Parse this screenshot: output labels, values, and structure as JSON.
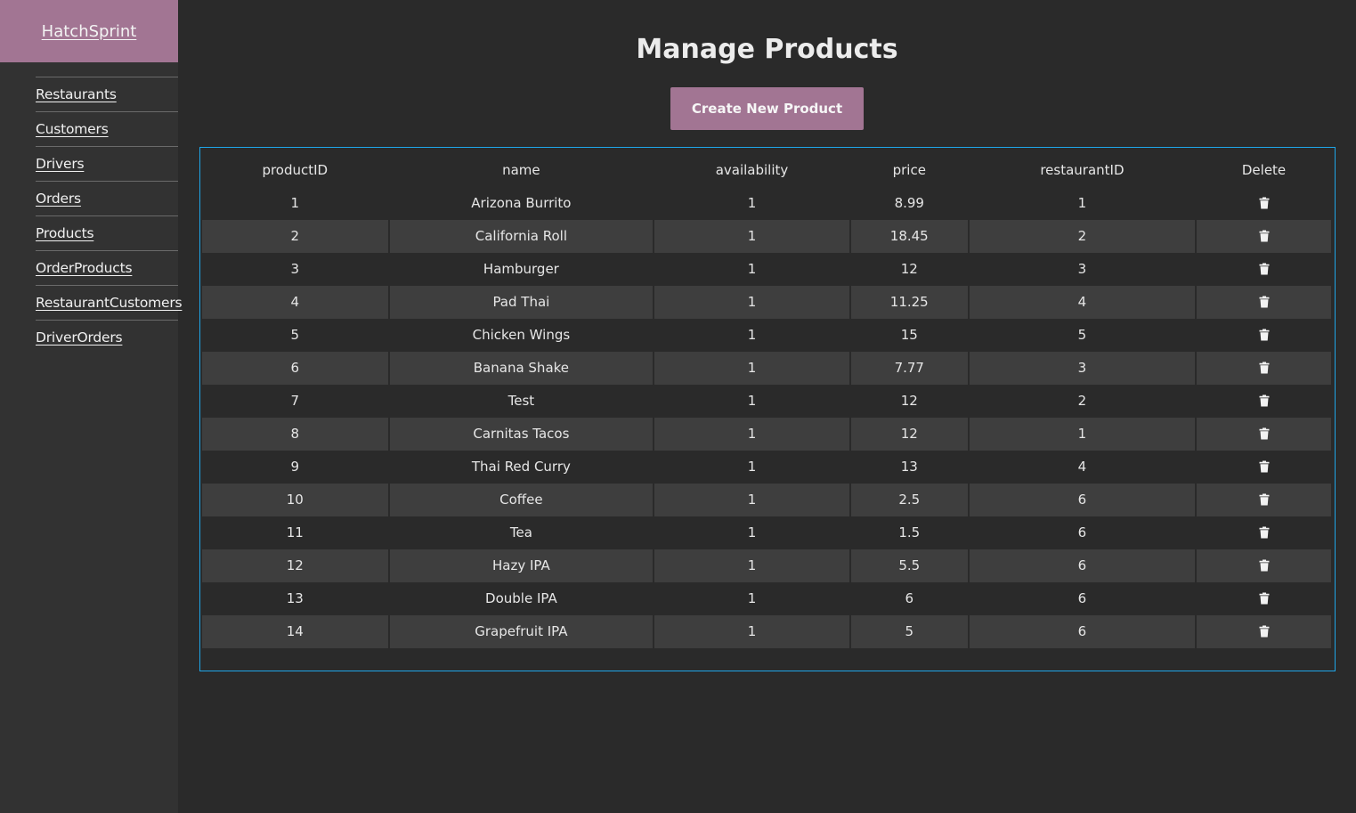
{
  "brand": {
    "label": "HatchSprint"
  },
  "sidebar": {
    "items": [
      {
        "label": "Restaurants"
      },
      {
        "label": "Customers"
      },
      {
        "label": "Drivers"
      },
      {
        "label": "Orders"
      },
      {
        "label": "Products"
      },
      {
        "label": "OrderProducts"
      },
      {
        "label": "RestaurantCustomers"
      },
      {
        "label": "DriverOrders"
      }
    ]
  },
  "page": {
    "title": "Manage Products",
    "create_button": "Create New Product"
  },
  "table": {
    "columns": [
      "productID",
      "name",
      "availability",
      "price",
      "restaurantID",
      "Delete"
    ],
    "delete_icon": "trash-icon",
    "rows": [
      {
        "productID": "1",
        "name": "Arizona Burrito",
        "availability": "1",
        "price": "8.99",
        "restaurantID": "1"
      },
      {
        "productID": "2",
        "name": "California Roll",
        "availability": "1",
        "price": "18.45",
        "restaurantID": "2"
      },
      {
        "productID": "3",
        "name": "Hamburger",
        "availability": "1",
        "price": "12",
        "restaurantID": "3"
      },
      {
        "productID": "4",
        "name": "Pad Thai",
        "availability": "1",
        "price": "11.25",
        "restaurantID": "4"
      },
      {
        "productID": "5",
        "name": "Chicken Wings",
        "availability": "1",
        "price": "15",
        "restaurantID": "5"
      },
      {
        "productID": "6",
        "name": "Banana Shake",
        "availability": "1",
        "price": "7.77",
        "restaurantID": "3"
      },
      {
        "productID": "7",
        "name": "Test",
        "availability": "1",
        "price": "12",
        "restaurantID": "2"
      },
      {
        "productID": "8",
        "name": "Carnitas Tacos",
        "availability": "1",
        "price": "12",
        "restaurantID": "1"
      },
      {
        "productID": "9",
        "name": "Thai Red Curry",
        "availability": "1",
        "price": "13",
        "restaurantID": "4"
      },
      {
        "productID": "10",
        "name": "Coffee",
        "availability": "1",
        "price": "2.5",
        "restaurantID": "6"
      },
      {
        "productID": "11",
        "name": "Tea",
        "availability": "1",
        "price": "1.5",
        "restaurantID": "6"
      },
      {
        "productID": "12",
        "name": "Hazy IPA",
        "availability": "1",
        "price": "5.5",
        "restaurantID": "6"
      },
      {
        "productID": "13",
        "name": "Double IPA",
        "availability": "1",
        "price": "6",
        "restaurantID": "6"
      },
      {
        "productID": "14",
        "name": "Grapefruit IPA",
        "availability": "1",
        "price": "5",
        "restaurantID": "6"
      }
    ]
  },
  "colors": {
    "accent": "#a27593",
    "background": "#2a2a2a",
    "sidebar": "#323232",
    "row_alt": "#3e3e3e",
    "table_border": "#1ea6e8"
  }
}
